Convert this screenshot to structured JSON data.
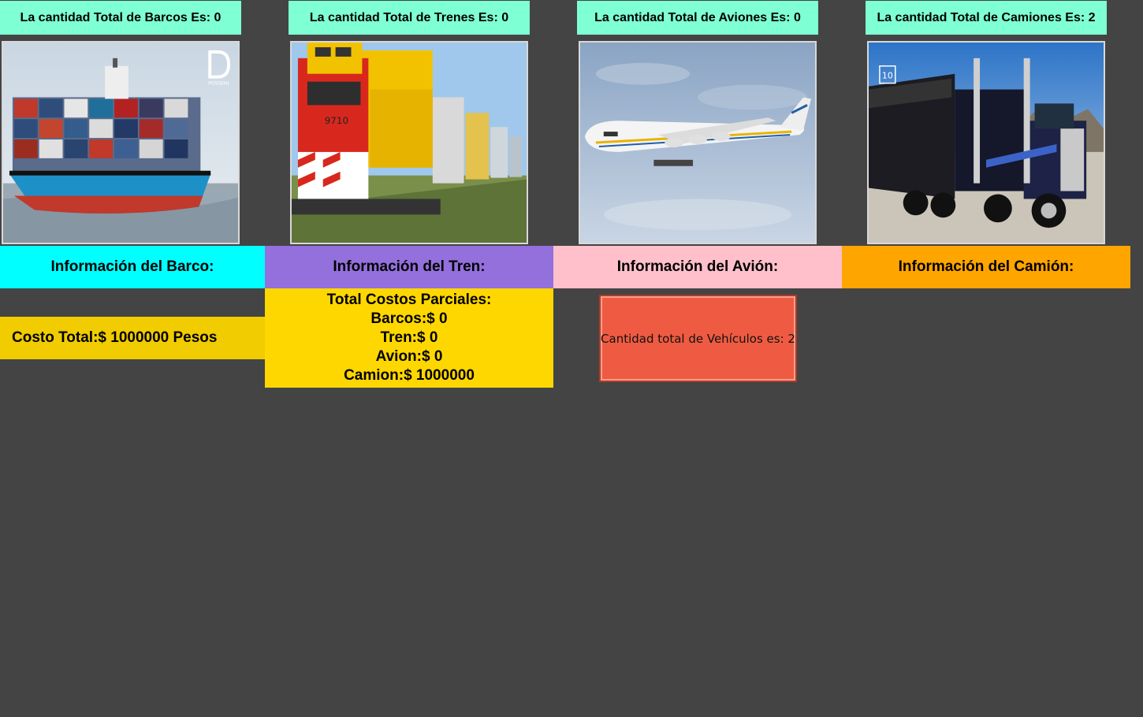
{
  "counts": {
    "barcos": "La cantidad Total de Barcos Es: 0",
    "trenes": "La cantidad Total de Trenes Es: 0",
    "aviones": "La cantidad Total de Aviones Es: 0",
    "camiones": "La cantidad Total de Camiones Es: 2"
  },
  "images": {
    "ship_logo_text": "POSSEHL",
    "train_number": "9710",
    "truck_logo_text": "10"
  },
  "headers": {
    "barco": "Información del Barco:",
    "tren": "Información del Tren:",
    "avion": "Información del Avión:",
    "camion": "Información del Camión:"
  },
  "costs": {
    "total": "Costo Total:$ 1000000 Pesos",
    "partial_title": "Total Costos Parciales:",
    "barcos": "Barcos:$ 0",
    "tren": "Tren:$ 0",
    "avion": "Avion:$ 0",
    "camion": "Camion:$ 1000000"
  },
  "vehicle_total_button": "Cantidad total de Vehículos es: 2",
  "colors": {
    "background": "#444444",
    "count_label": "#7fffd4",
    "header_barco": "#00ffff",
    "header_tren": "#9370db",
    "header_avion": "#ffc0cb",
    "header_camion": "#ffa500",
    "cost_total": "#f0cc00",
    "partial_costs": "#ffd700",
    "vehicle_button": "#ef5b42"
  }
}
